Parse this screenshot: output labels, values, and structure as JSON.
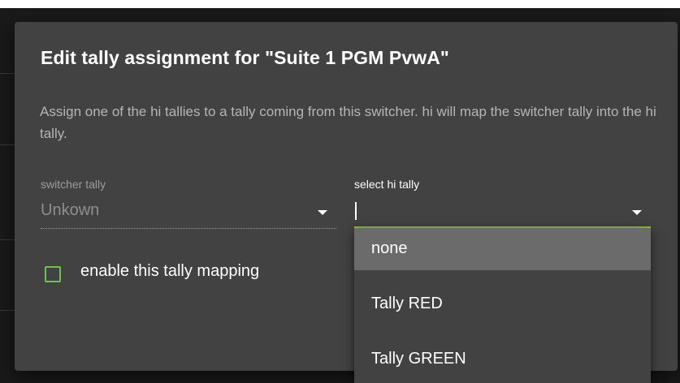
{
  "dialog": {
    "title": "Edit tally assignment for \"Suite 1 PGM PvwA\"",
    "description": "Assign one of the hi tallies to a tally coming from this switcher. hi will map the switcher tally into the hi tally.",
    "switcher_tally": {
      "label": "switcher tally",
      "value": "Unkown"
    },
    "hi_tally": {
      "label": "select hi tally",
      "value": ""
    },
    "enable_mapping": {
      "label": "enable this tally mapping",
      "checked": false
    }
  },
  "hi_tally_menu": {
    "items": [
      "none",
      "Tally RED",
      "Tally GREEN"
    ],
    "selected_index": 0
  },
  "colors": {
    "accent_green": "#8bc34a",
    "dialog_background": "#424242",
    "selected_item": "#6b6b6b"
  },
  "icons": [
    "chevron-down-icon",
    "checkbox-icon"
  ]
}
